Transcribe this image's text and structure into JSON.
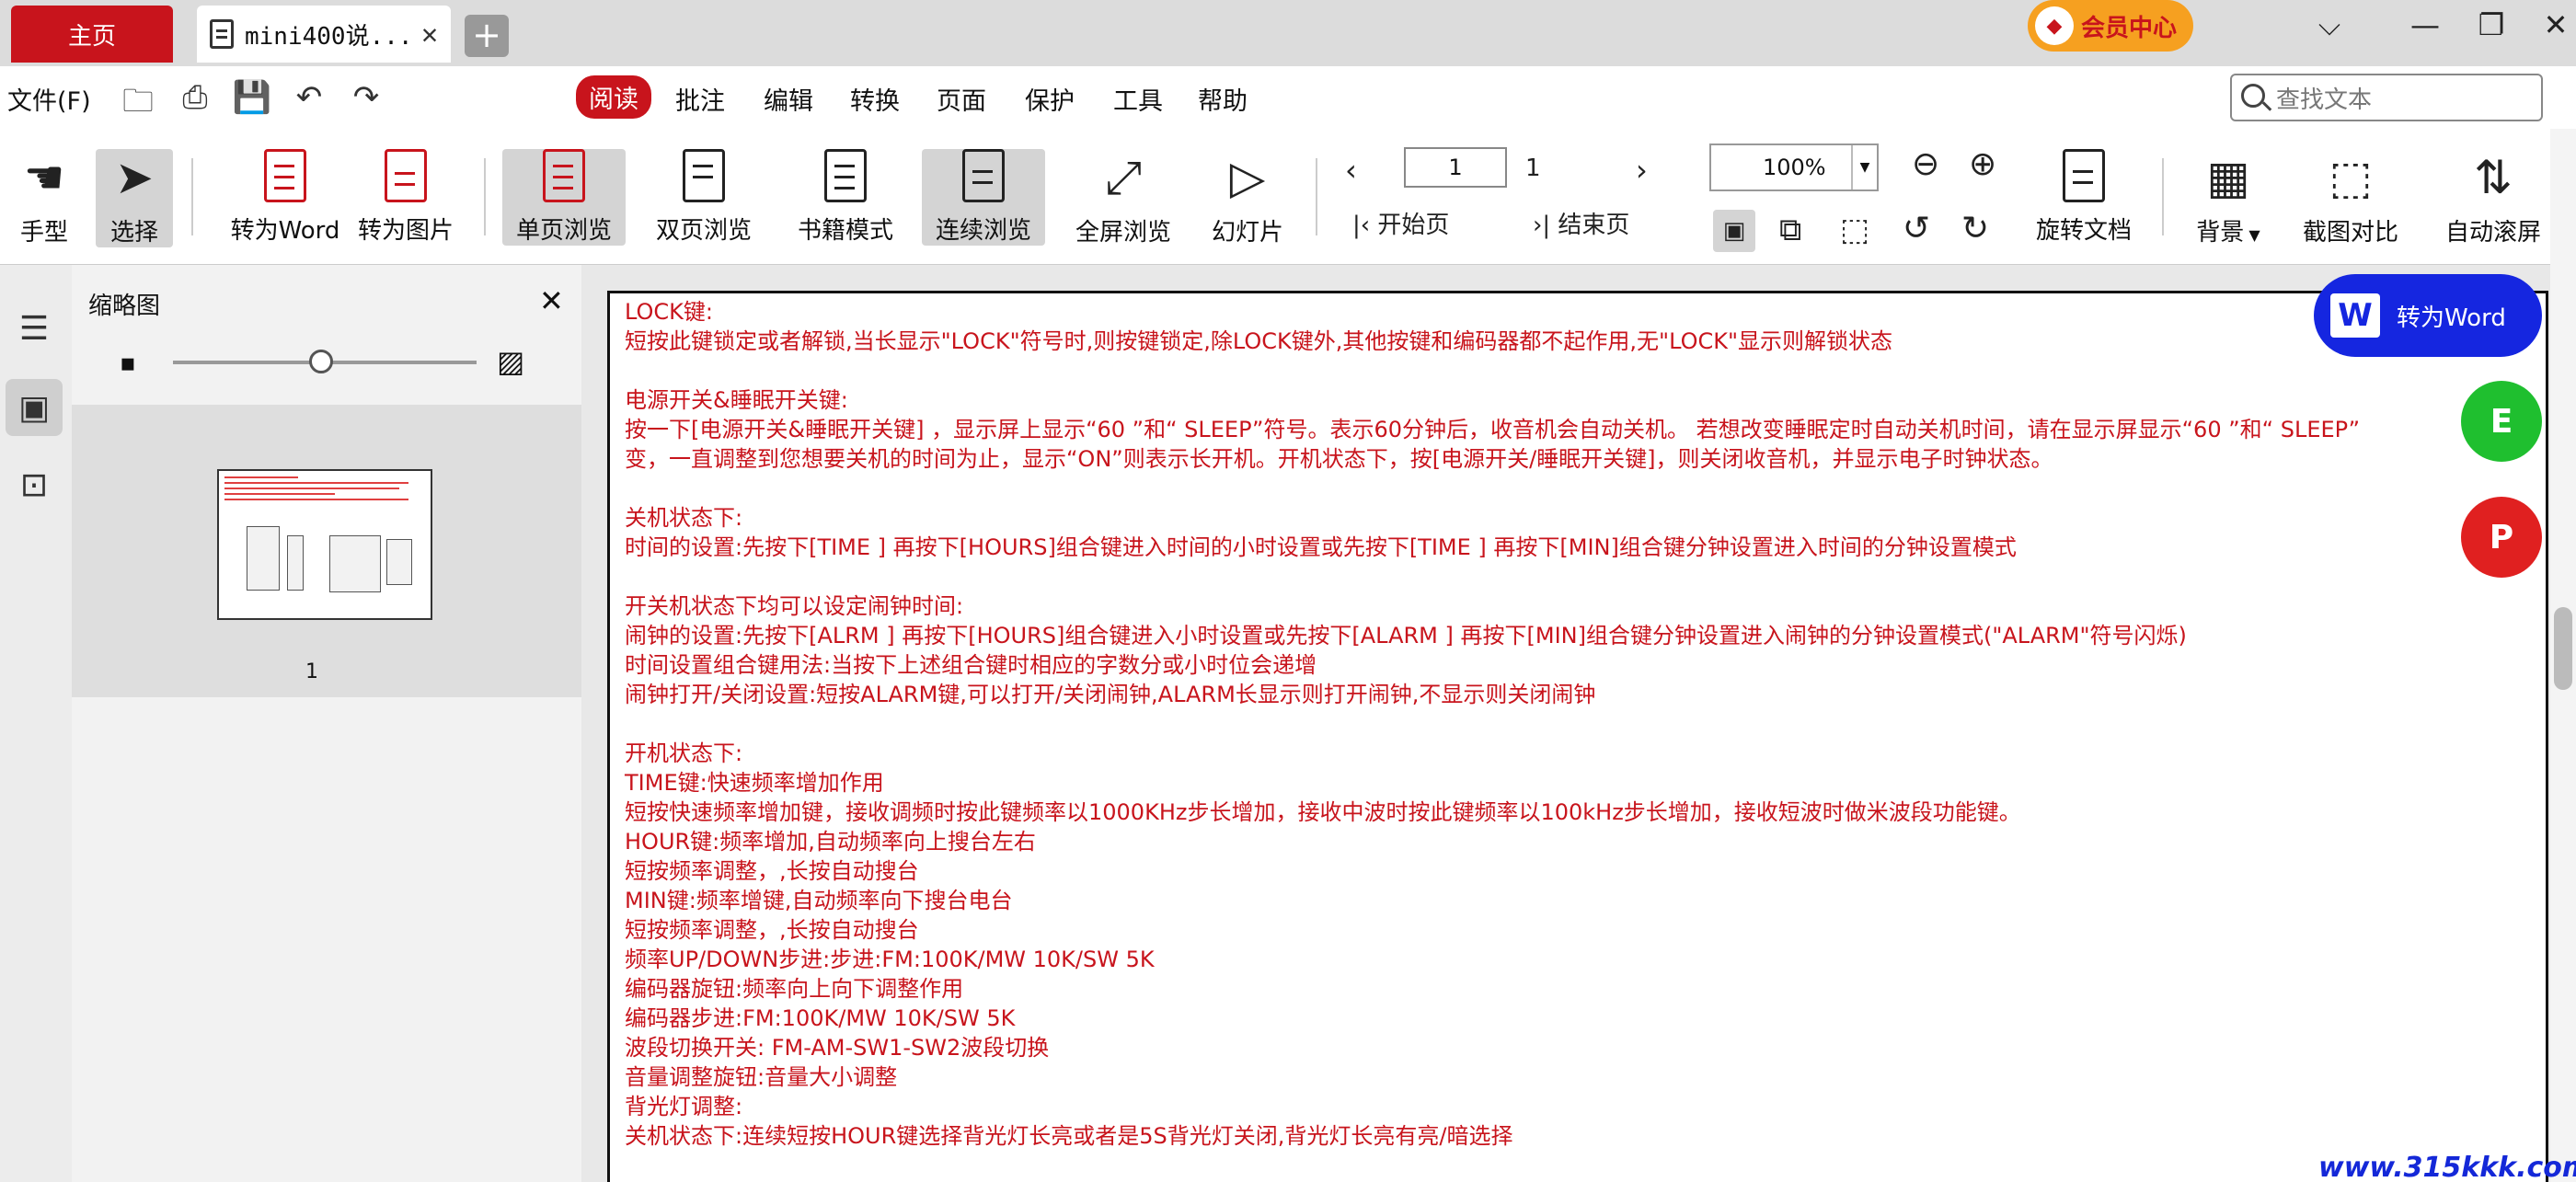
{
  "tabs": {
    "home": "主页",
    "doc": "mini400说...",
    "add": "+"
  },
  "vip": {
    "label": "会员中心",
    "icon": "vip-diamond-icon"
  },
  "window": {
    "menu": "⌵",
    "minimize": "—",
    "restore": "❐",
    "close": "✕"
  },
  "menu": {
    "file": "文件(F)",
    "items": [
      "阅读",
      "批注",
      "编辑",
      "转换",
      "页面",
      "保护",
      "工具",
      "帮助"
    ],
    "active": "阅读"
  },
  "search": {
    "placeholder": "查找文本"
  },
  "toolbar": {
    "hand": "手型",
    "select": "选择",
    "to_word": "转为Word",
    "to_image": "转为图片",
    "single_page": "单页浏览",
    "double_page": "双页浏览",
    "book_mode": "书籍模式",
    "continuous": "连续浏览",
    "fullscreen": "全屏浏览",
    "slideshow": "幻灯片",
    "page_current": "1",
    "page_total": "1",
    "first_page": "开始页",
    "last_page": "结束页",
    "zoom": "100%",
    "rotate_doc": "旋转文档",
    "background": "背景",
    "compare": "截图对比",
    "auto_scroll": "自动滚屏"
  },
  "sidebar": {
    "title": "缩略图",
    "close": "✕",
    "page_label": "1"
  },
  "floating": {
    "to_word": "转为Word",
    "excel": "E",
    "ppt": "P"
  },
  "document": {
    "lines": [
      "LOCK键:",
      "短按此键锁定或者解锁,当长显示\"LOCK\"符号时,则按键锁定,除LOCK键外,其他按键和编码器都不起作用,无\"LOCK\"显示则解锁状态",
      "",
      "电源开关&睡眠开关键:",
      "按一下[电源开关&睡眠开关键] ，显示屏上显示“60 ”和“ SLEEP”符号。表示60分钟后，收音机会自动关机。    若想改变睡眠定时自动关机时间，请在显示屏显示“60 ”和“ SLEEP”",
      "变，一直调整到您想要关机的时间为止，显示“ON”则表示长开机。开机状态下，按[电源开关/睡眠开关键]，则关闭收音机，并显示电子时钟状态。",
      "",
      "关机状态下:",
      "时间的设置:先按下[TIME ] 再按下[HOURS]组合键进入时间的小时设置或先按下[TIME ] 再按下[MIN]组合键分钟设置进入时间的分钟设置模式",
      "",
      "开关机状态下均可以设定闹钟时间:",
      "闹钟的设置:先按下[ALRM ] 再按下[HOURS]组合键进入小时设置或先按下[ALARM ] 再按下[MIN]组合键分钟设置进入闹钟的分钟设置模式(\"ALARM\"符号闪烁)",
      " 时间设置组合键用法:当按下上述组合键时相应的字数分或小时位会递增",
      "闹钟打开/关闭设置:短按ALARM键,可以打开/关闭闹钟,ALARM长显示则打开闹钟,不显示则关闭闹钟",
      "",
      "开机状态下:",
      "TIME键:快速频率增加作用",
      "短按快速频率增加键，接收调频时按此键频率以1000KHz步长增加，接收中波时按此键频率以100kHz步长增加，接收短波时做米波段功能键。",
      "HOUR键:频率增加,自动频率向上搜台左右",
      "短按频率调整，,长按自动搜台",
      "MIN键:频率增键,自动频率向下搜台电台",
      "短按频率调整，,长按自动搜台",
      "频率UP/DOWN步进:步进:FM:100K/MW 10K/SW 5K",
      "编码器旋钮:频率向上向下调整作用",
      "编码器步进:FM:100K/MW 10K/SW 5K",
      "波段切换开关:  FM-AM-SW1-SW2波段切换",
      "音量调整旋钮:音量大小调整",
      "背光灯调整:",
      "关机状态下:连续短按HOUR键选择背光灯长亮或者是5S背光灯关闭,背光灯长亮有亮/暗选择"
    ]
  },
  "watermark": "www.315kkk.com",
  "colors": {
    "brand_red": "#c8141c",
    "doc_text": "#c8141c",
    "word_blue": "#1526e0",
    "excel_green": "#1fbf2f",
    "ppt_red": "#e02020"
  }
}
